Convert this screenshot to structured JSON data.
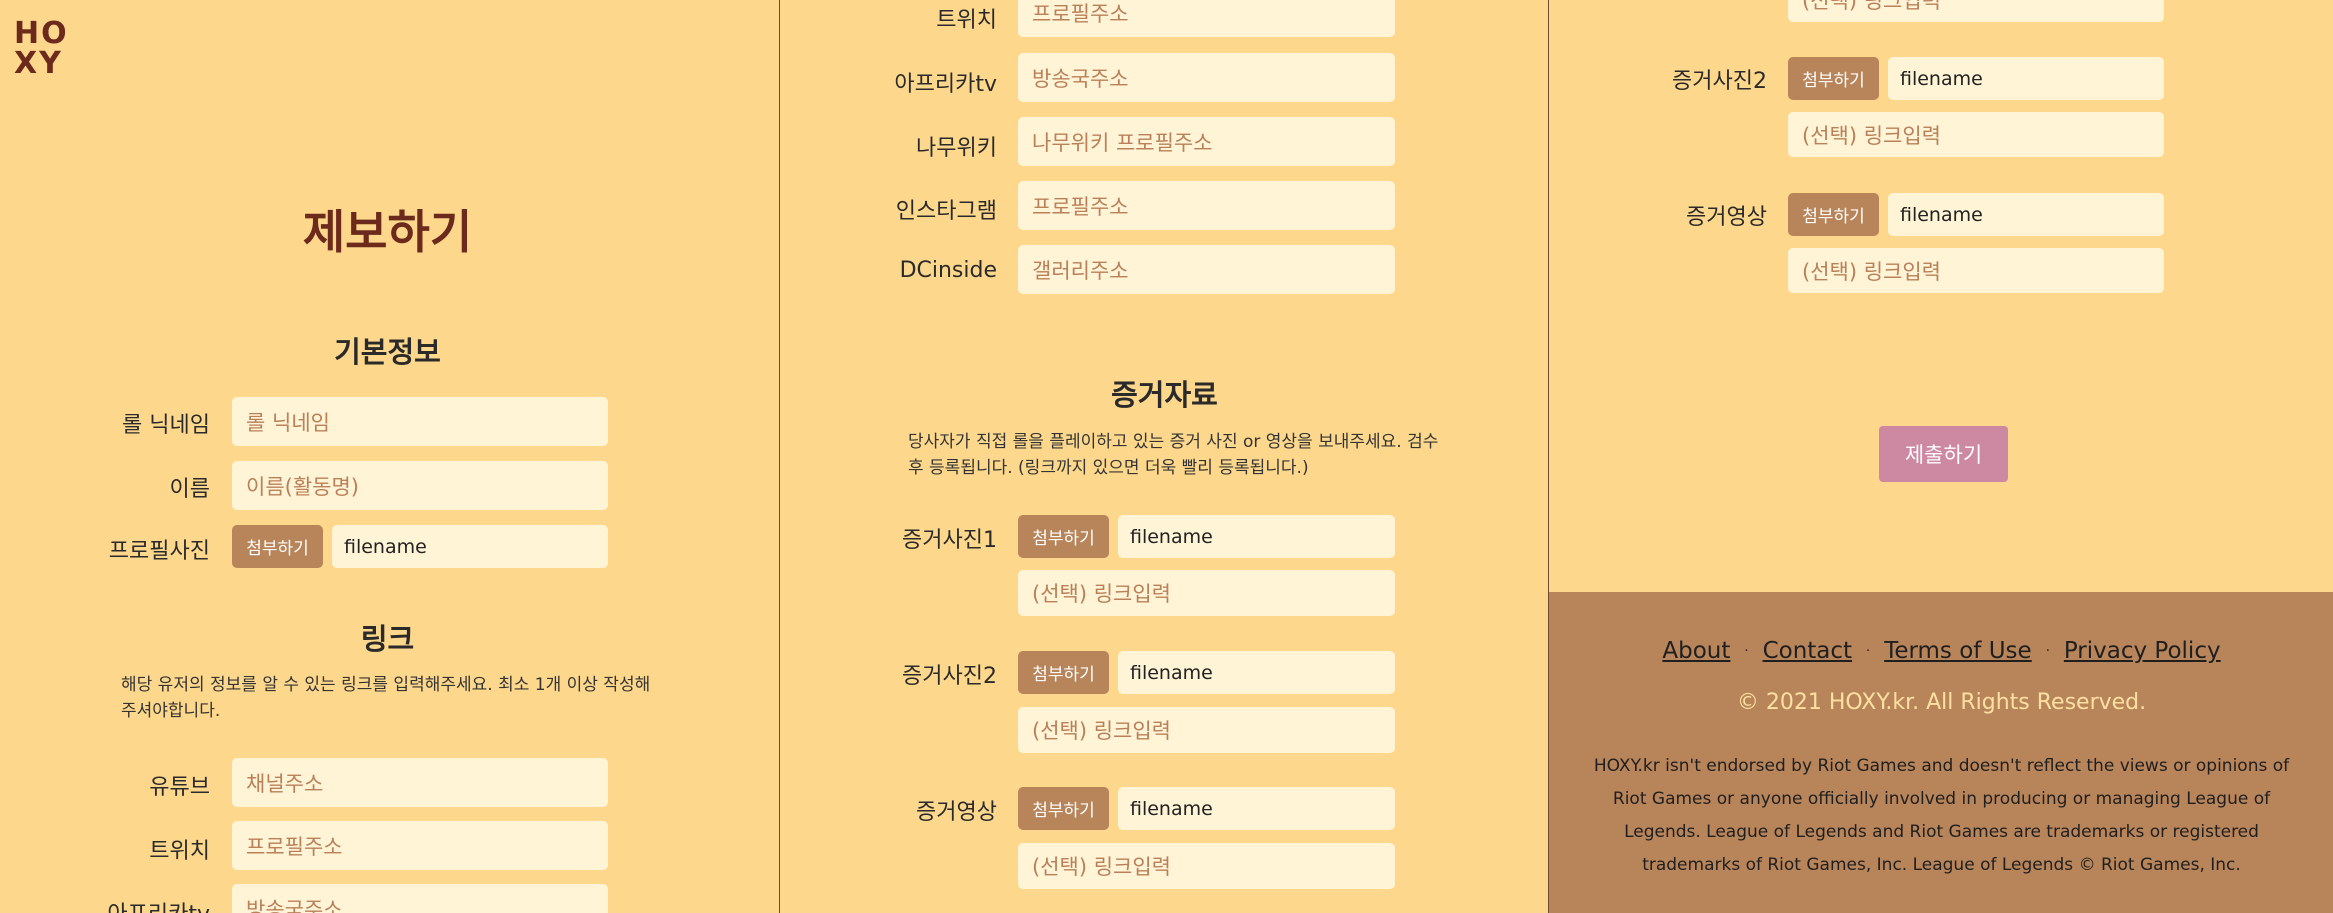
{
  "brand": {
    "logo_line1": "HO",
    "logo_line2": "XY"
  },
  "page_title": "제보하기",
  "basic": {
    "title": "기본정보",
    "nickname_label": "롤 닉네임",
    "nickname_placeholder": "롤 닉네임",
    "name_label": "이름",
    "name_placeholder": "이름(활동명)",
    "profile_label": "프로필사진",
    "attach_label": "첨부하기",
    "filename": "filename"
  },
  "links": {
    "title": "링크",
    "description_line1": "해당 유저의 정보를 알 수 있는 링크를 입력해주세요. 최소 1개 이상 작성해",
    "description_line2": "주셔야합니다.",
    "youtube_label": "유튜브",
    "youtube_placeholder": "채널주소",
    "twitch_label": "트위치",
    "twitch_placeholder": "프로필주소",
    "afreeca_label": "아프리카tv",
    "afreeca_placeholder": "방송국주소",
    "namuwiki_label": "나무위키",
    "namuwiki_placeholder": "나무위키 프로필주소",
    "instagram_label": "인스타그램",
    "instagram_placeholder": "프로필주소",
    "dcinside_label": "DCinside",
    "dcinside_placeholder": "갤러리주소"
  },
  "evidence": {
    "title": "증거자료",
    "description_line1": "당사자가 직접 롤을 플레이하고 있는 증거 사진 or 영상을 보내주세요. 검수",
    "description_line2": "후 등록됩니다. (링크까지 있으면 더욱 빨리 등록됩니다.)",
    "photo1_label": "증거사진1",
    "photo2_label": "증거사진2",
    "video_label": "증거영상",
    "attach_label": "첨부하기",
    "filename": "filename",
    "link_placeholder": "(선택) 링크입력"
  },
  "submit_label": "제출하기",
  "footer": {
    "links": [
      "About",
      "Contact",
      "Terms of Use",
      "Privacy Policy"
    ],
    "separator": "·",
    "copyright": "© 2021 HOXY.kr. All Rights Reserved.",
    "disclaimer": "HOXY.kr isn't endorsed by Riot Games and doesn't reflect the views or opinions of Riot Games or anyone officially involved in producing or managing League of Legends. League of Legends and Riot Games are trademarks or registered trademarks of Riot Games, Inc. League of Legends © Riot Games, Inc."
  },
  "colors": {
    "background": "#fdd88c",
    "input_bg": "#fff4d6",
    "attach_button": "#b8845a",
    "title": "#6b2a1b",
    "submit_button": "#cd88a2",
    "footer_bg": "#b8845a"
  }
}
